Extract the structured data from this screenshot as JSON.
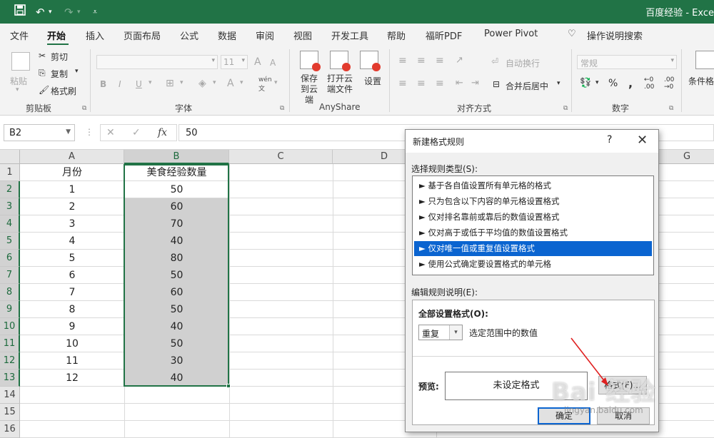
{
  "titlebar": {
    "title": "百度经验 - Exce",
    "save_icon": "floppy-disk-icon",
    "undo_icon": "undo-arrow-icon",
    "redo_icon": "redo-arrow-icon"
  },
  "ribbon_tabs": [
    "文件",
    "开始",
    "插入",
    "页面布局",
    "公式",
    "数据",
    "审阅",
    "视图",
    "开发工具",
    "帮助",
    "福昕PDF",
    "Power Pivot",
    "操作说明搜索"
  ],
  "ribbon": {
    "clipboard": {
      "paste": "粘贴",
      "cut": "剪切",
      "copy": "复制",
      "format_painter": "格式刷",
      "group": "剪贴板"
    },
    "font": {
      "size": "11",
      "group": "字体",
      "bold": "B",
      "italic": "I",
      "underline": "U"
    },
    "anyshare": {
      "save": "保存到云端",
      "open": "打开云端文件",
      "settings": "设置",
      "group": "AnyShare"
    },
    "alignment": {
      "wrap": "自动换行",
      "merge": "合并后居中",
      "group": "对齐方式"
    },
    "number": {
      "format": "常规",
      "percent": "%",
      "comma": ",",
      "group": "数字"
    },
    "styles": {
      "conditional": "条件格"
    }
  },
  "formula_bar": {
    "name_box": "B2",
    "fx": "fx",
    "value": "50"
  },
  "sheet": {
    "columns": [
      "A",
      "B",
      "C",
      "D",
      "G"
    ],
    "header_row": {
      "a": "月份",
      "b": "美食经验数量"
    },
    "rows": [
      {
        "a": "1",
        "b": "50"
      },
      {
        "a": "2",
        "b": "60"
      },
      {
        "a": "3",
        "b": "70"
      },
      {
        "a": "4",
        "b": "40"
      },
      {
        "a": "5",
        "b": "80"
      },
      {
        "a": "6",
        "b": "50"
      },
      {
        "a": "7",
        "b": "60"
      },
      {
        "a": "8",
        "b": "50"
      },
      {
        "a": "9",
        "b": "40"
      },
      {
        "a": "10",
        "b": "50"
      },
      {
        "a": "11",
        "b": "30"
      },
      {
        "a": "12",
        "b": "40"
      }
    ],
    "row_numbers": [
      "1",
      "2",
      "3",
      "4",
      "5",
      "6",
      "7",
      "8",
      "9",
      "10",
      "11",
      "12",
      "13",
      "14",
      "15",
      "16"
    ]
  },
  "dialog": {
    "title": "新建格式规则",
    "help": "?",
    "close": "✕",
    "select_rule_label": "选择规则类型(S):",
    "rule_types": [
      "► 基于各自值设置所有单元格的格式",
      "► 只为包含以下内容的单元格设置格式",
      "► 仅对排名靠前或靠后的数值设置格式",
      "► 仅对高于或低于平均值的数值设置格式",
      "► 仅对唯一值或重复值设置格式",
      "► 使用公式确定要设置格式的单元格"
    ],
    "selected_rule_index": 4,
    "edit_rule_label": "编辑规则说明(E):",
    "format_all_label": "全部设置格式(O):",
    "duplicate_value": "重复",
    "in_range_text": "选定范围中的数值",
    "preview_label": "预览:",
    "preview_text": "未设定格式",
    "format_button": "格式(F)...",
    "ok": "确定",
    "cancel": "取消"
  },
  "watermark": {
    "text": "Bai 经验",
    "url": "jingyan.baidu.com"
  },
  "colors": {
    "excel_green": "#217346",
    "selection_blue": "#0a64d0",
    "annotation_red": "#e02020"
  }
}
